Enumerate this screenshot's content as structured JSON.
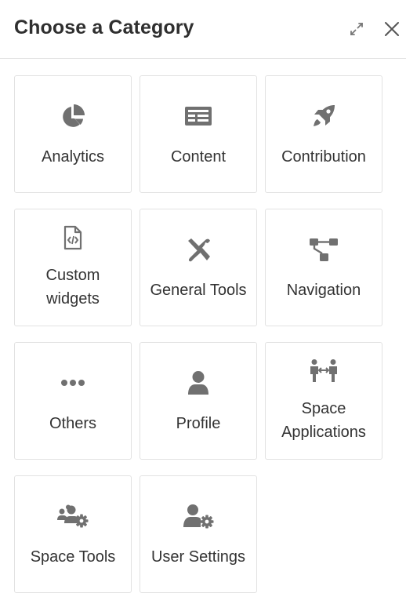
{
  "dialog": {
    "title": "Choose a Category",
    "expand_icon": "expand-icon",
    "close_icon": "close-icon"
  },
  "categories": [
    {
      "label": "Analytics",
      "icon": "pie-chart-icon"
    },
    {
      "label": "Content",
      "icon": "newspaper-icon"
    },
    {
      "label": "Contribution",
      "icon": "rocket-icon"
    },
    {
      "label": "Custom widgets",
      "line1": "Custom",
      "line2": "widgets",
      "icon": "code-file-icon"
    },
    {
      "label": "General Tools",
      "icon": "tools-icon"
    },
    {
      "label": "Navigation",
      "icon": "sitemap-icon"
    },
    {
      "label": "Others",
      "icon": "ellipsis-icon"
    },
    {
      "label": "Profile",
      "icon": "user-icon"
    },
    {
      "label": "Space Applications",
      "line1": "Space",
      "line2": "Applications",
      "icon": "users-exchange-icon"
    },
    {
      "label": "Space Tools",
      "icon": "users-gear-icon"
    },
    {
      "label": "User Settings",
      "icon": "user-gear-icon"
    }
  ],
  "colors": {
    "icon": "#707070",
    "text": "#333333",
    "border": "#e2e2e2"
  }
}
